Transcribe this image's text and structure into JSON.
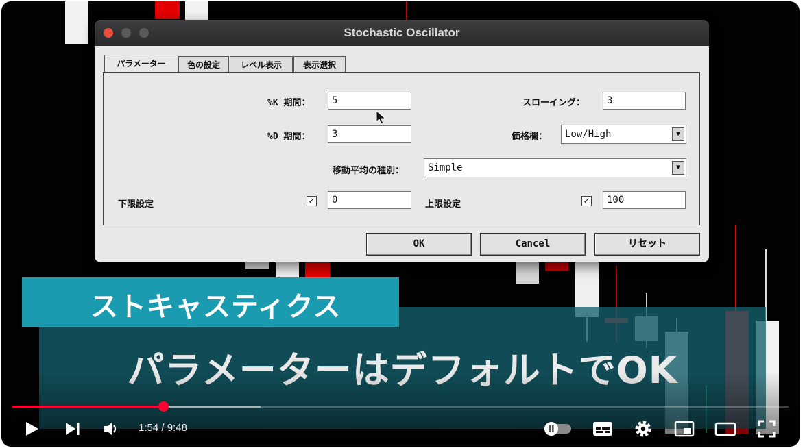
{
  "dialog": {
    "title": "Stochastic Oscillator",
    "tabs": [
      {
        "label": "パラメーター",
        "active": true
      },
      {
        "label": "色の設定",
        "active": false
      },
      {
        "label": "レベル表示",
        "active": false
      },
      {
        "label": "表示選択",
        "active": false
      }
    ],
    "k_period": {
      "label": "%K 期間：",
      "value": "5"
    },
    "d_period": {
      "label": "%D 期間：",
      "value": "3"
    },
    "slowing": {
      "label": "スローイング：",
      "value": "3"
    },
    "price_field": {
      "label": "価格欄：",
      "value": "Low/High"
    },
    "ma_method": {
      "label": "移動平均の種別：",
      "value": "Simple"
    },
    "lower_level": {
      "label": "下限設定",
      "checked": true,
      "value": "0"
    },
    "upper_level": {
      "label": "上限設定",
      "checked": true,
      "value": "100"
    },
    "buttons": {
      "ok": "OK",
      "cancel": "Cancel",
      "reset": "リセット"
    }
  },
  "captions": {
    "heading": "ストキャスティクス",
    "subtitle": "パラメーターはデフォルトでOK"
  },
  "player": {
    "current_time": "1:54",
    "separator": "/",
    "duration": "9:48",
    "progress_fraction": 0.194,
    "accent_color": "#ff0033"
  }
}
